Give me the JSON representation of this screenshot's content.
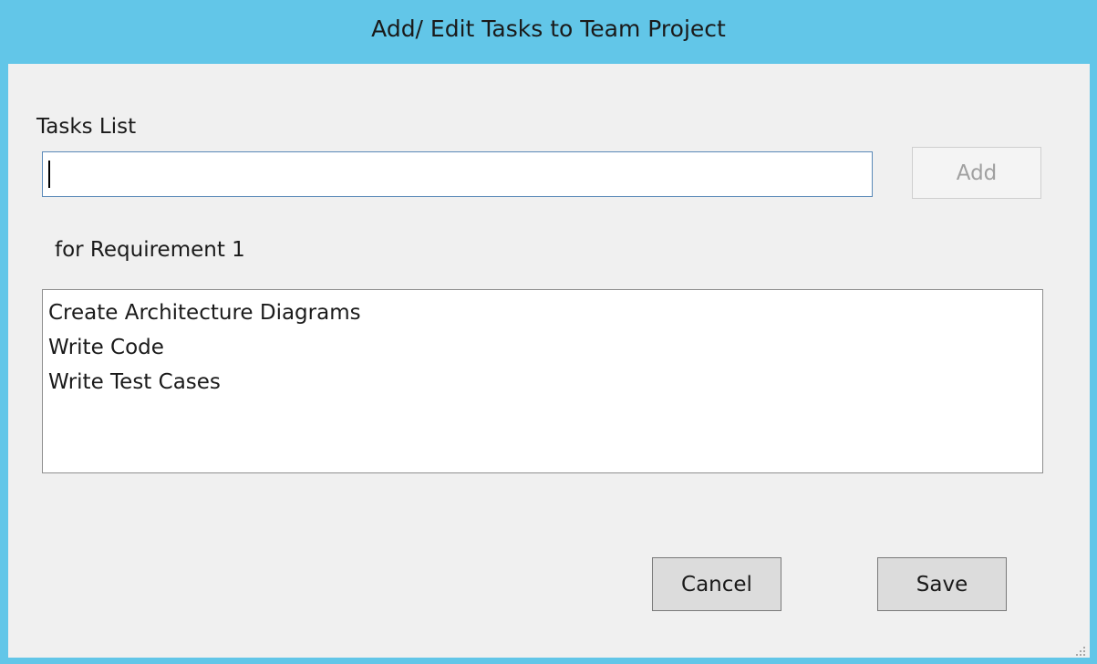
{
  "window": {
    "title": "Add/ Edit Tasks to Team Project"
  },
  "tasks": {
    "label": "Tasks List",
    "input_value": "",
    "input_placeholder": "",
    "add_label": "Add"
  },
  "requirement": {
    "label": "for Requirement 1"
  },
  "task_list": {
    "items": [
      "Create Architecture Diagrams",
      "Write Code",
      "Write Test Cases"
    ]
  },
  "footer": {
    "cancel_label": "Cancel",
    "save_label": "Save"
  },
  "icons": {
    "resize_grip": "resize-grip-icon"
  },
  "colors": {
    "titlebar": "#62c6e8",
    "client_background": "#f0f0f0",
    "input_border": "#5a89b8",
    "disabled_text": "#a0a0a0"
  }
}
